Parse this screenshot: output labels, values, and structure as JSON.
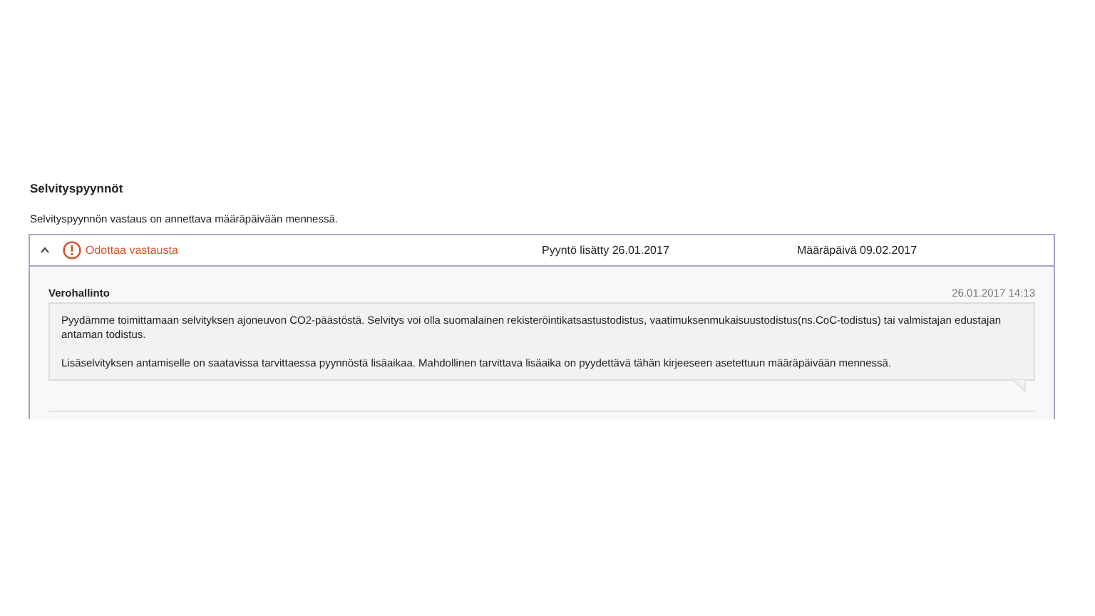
{
  "section": {
    "title": "Selvityspyynnöt",
    "description": "Selvityspyynnön vastaus on annettava määräpäivään mennessä."
  },
  "request": {
    "expanded": true,
    "status": "Odottaa vastausta",
    "added": "Pyyntö lisätty 26.01.2017",
    "deadline": "Määräpäivä 09.02.2017",
    "message": {
      "sender": "Verohallinto",
      "timestamp": "26.01.2017 14:13",
      "paragraphs": [
        "Pyydämme toimittamaan selvityksen ajoneuvon CO2-päästöstä. Selvitys voi olla suomalainen rekisteröintikatsastustodistus, vaatimuksenmukaisuustodistus(ns.CoC-todistus) tai valmistajan edustajan antaman todistus.",
        "Lisäselvityksen antamiselle on saatavissa tarvittaessa pyynnöstä lisäaikaa. Mahdollinen tarvittava lisäaika on pyydettävä tähän kirjeeseen asetettuun määräpäivään mennessä."
      ]
    }
  }
}
